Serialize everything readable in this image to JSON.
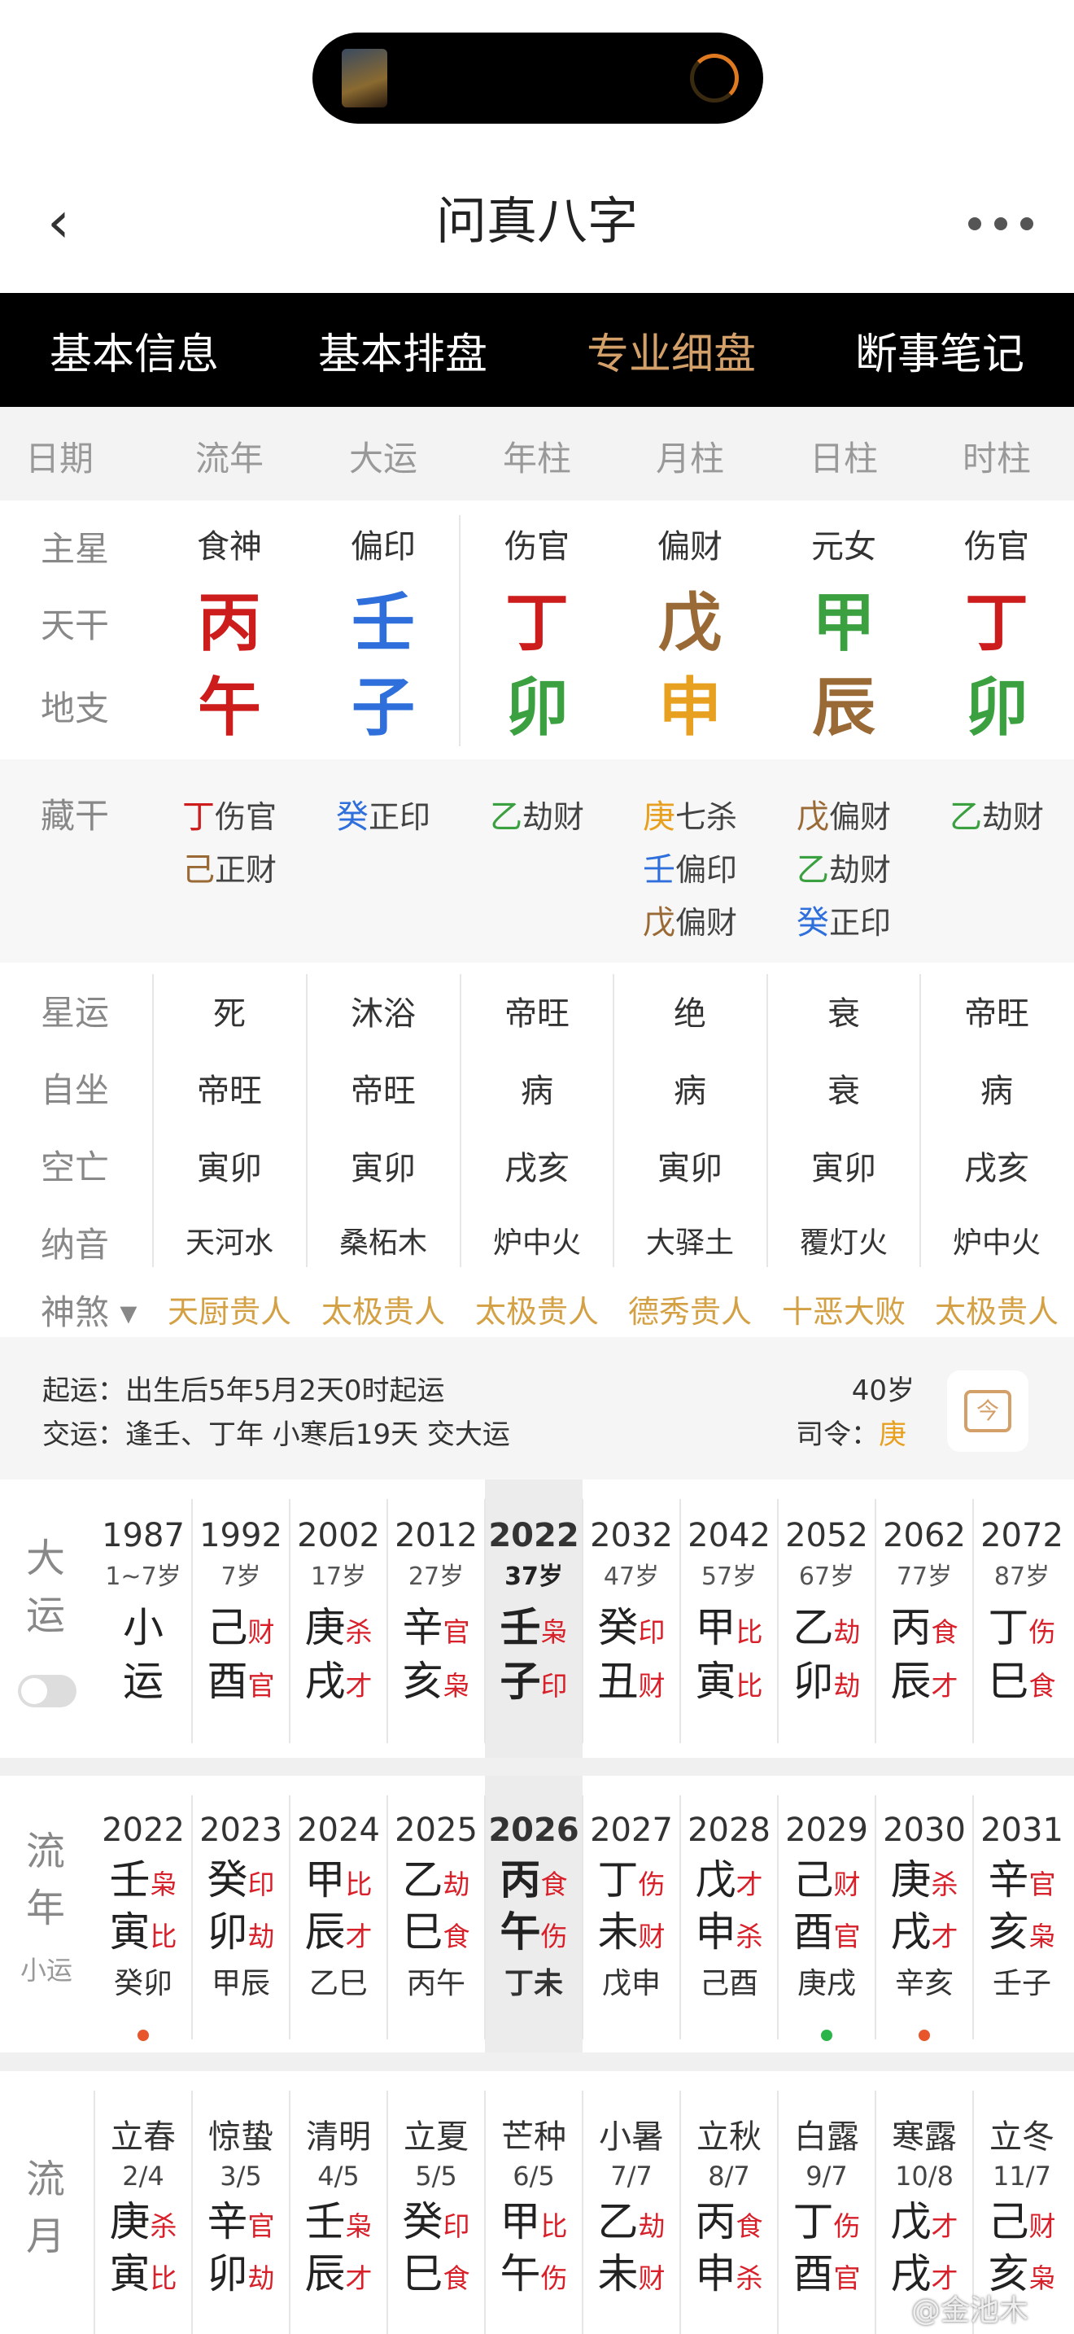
{
  "header": {
    "title": "问真八字",
    "back_icon": "chevron-left-icon",
    "more_icon": "more-dots-icon"
  },
  "tabs": [
    {
      "label": "基本信息"
    },
    {
      "label": "基本排盘"
    },
    {
      "label": "专业细盘",
      "active": true
    },
    {
      "label": "断事笔记"
    }
  ],
  "columns": [
    "日期",
    "流年",
    "大运",
    "年柱",
    "月柱",
    "日柱",
    "时柱"
  ],
  "rows": {
    "zhuxing": {
      "label": "主星",
      "values": [
        "食神",
        "偏印",
        "伤官",
        "偏财",
        "元女",
        "伤官"
      ]
    },
    "tiangan": {
      "label": "天干",
      "values": [
        {
          "t": "丙",
          "c": "#cc1c1c"
        },
        {
          "t": "壬",
          "c": "#2f6fdc"
        },
        {
          "t": "丁",
          "c": "#cc1c1c"
        },
        {
          "t": "戊",
          "c": "#9a6a36"
        },
        {
          "t": "甲",
          "c": "#3aa040"
        },
        {
          "t": "丁",
          "c": "#cc1c1c"
        }
      ]
    },
    "dizhi": {
      "label": "地支",
      "values": [
        {
          "t": "午",
          "c": "#cc1c1c"
        },
        {
          "t": "子",
          "c": "#2f6fdc"
        },
        {
          "t": "卯",
          "c": "#3aa040"
        },
        {
          "t": "申",
          "c": "#e8a020"
        },
        {
          "t": "辰",
          "c": "#9a6a36"
        },
        {
          "t": "卯",
          "c": "#3aa040"
        }
      ]
    }
  },
  "canggan": {
    "label": "藏干",
    "pin_icon": "pin-icon",
    "columns": [
      [
        {
          "g": "丁",
          "c": "#cc1c1c",
          "s": "伤官"
        },
        {
          "g": "己",
          "c": "#9a6a36",
          "s": "正财"
        }
      ],
      [
        {
          "g": "癸",
          "c": "#2f6fdc",
          "s": "正印"
        }
      ],
      [
        {
          "g": "乙",
          "c": "#3aa040",
          "s": "劫财"
        }
      ],
      [
        {
          "g": "庚",
          "c": "#e8a020",
          "s": "七杀"
        },
        {
          "g": "壬",
          "c": "#2f6fdc",
          "s": "偏印"
        },
        {
          "g": "戊",
          "c": "#9a6a36",
          "s": "偏财"
        }
      ],
      [
        {
          "g": "戊",
          "c": "#9a6a36",
          "s": "偏财"
        },
        {
          "g": "乙",
          "c": "#3aa040",
          "s": "劫财"
        },
        {
          "g": "癸",
          "c": "#2f6fdc",
          "s": "正印"
        }
      ],
      [
        {
          "g": "乙",
          "c": "#3aa040",
          "s": "劫财"
        }
      ]
    ]
  },
  "xingyun": {
    "label": "星运",
    "values": [
      "死",
      "沐浴",
      "帝旺",
      "绝",
      "衰",
      "帝旺"
    ]
  },
  "zizuo": {
    "label": "自坐",
    "values": [
      "帝旺",
      "帝旺",
      "病",
      "病",
      "衰",
      "病"
    ]
  },
  "kongwang": {
    "label": "空亡",
    "values": [
      "寅卯",
      "寅卯",
      "戌亥",
      "寅卯",
      "寅卯",
      "戌亥"
    ]
  },
  "nayin": {
    "label": "纳音",
    "values": [
      "天河水",
      "桑柘木",
      "炉中火",
      "大驿土",
      "覆灯火",
      "炉中火"
    ]
  },
  "shensha": {
    "label": "神煞",
    "values": [
      "天厨贵人",
      "太极贵人",
      "太极贵人",
      "德秀贵人",
      "十恶大败",
      "太极贵人"
    ]
  },
  "qiyun": {
    "line1": "起运：出生后5年5月2天0时起运",
    "line2": "交运：逢壬、丁年 小寒后19天 交大运",
    "age": "40岁",
    "siling_label": "司令：",
    "siling_value": "庚",
    "cal_icon": "calendar-icon",
    "cal_char": "今"
  },
  "dayun": {
    "label": "大运",
    "items": [
      {
        "year": "1987",
        "age": "1~7岁",
        "top": {
          "g": "小",
          "c": "#333"
        },
        "bot": {
          "g": "运",
          "c": "#333"
        }
      },
      {
        "year": "1992",
        "age": "7岁",
        "top": {
          "g": "己",
          "c": "#333",
          "s": "财"
        },
        "bot": {
          "g": "酉",
          "c": "#333",
          "s": "官"
        }
      },
      {
        "year": "2002",
        "age": "17岁",
        "top": {
          "g": "庚",
          "s": "杀"
        },
        "bot": {
          "g": "戌",
          "s": "才"
        }
      },
      {
        "year": "2012",
        "age": "27岁",
        "top": {
          "g": "辛",
          "s": "官"
        },
        "bot": {
          "g": "亥",
          "s": "枭"
        }
      },
      {
        "year": "2022",
        "age": "37岁",
        "top": {
          "g": "壬",
          "s": "枭"
        },
        "bot": {
          "g": "子",
          "s": "印"
        },
        "current": true
      },
      {
        "year": "2032",
        "age": "47岁",
        "top": {
          "g": "癸",
          "s": "印"
        },
        "bot": {
          "g": "丑",
          "s": "财"
        }
      },
      {
        "year": "2042",
        "age": "57岁",
        "top": {
          "g": "甲",
          "s": "比"
        },
        "bot": {
          "g": "寅",
          "s": "比"
        }
      },
      {
        "year": "2052",
        "age": "67岁",
        "top": {
          "g": "乙",
          "s": "劫"
        },
        "bot": {
          "g": "卯",
          "s": "劫"
        }
      },
      {
        "year": "2062",
        "age": "77岁",
        "top": {
          "g": "丙",
          "s": "食"
        },
        "bot": {
          "g": "辰",
          "s": "才"
        }
      },
      {
        "year": "2072",
        "age": "87岁",
        "top": {
          "g": "丁",
          "s": "伤"
        },
        "bot": {
          "g": "巳",
          "s": "食"
        }
      }
    ]
  },
  "liunian": {
    "label1": "流",
    "label2": "年",
    "sublabel": "小运",
    "items": [
      {
        "year": "2022",
        "top": {
          "g": "壬",
          "s": "枭"
        },
        "bot": {
          "g": "寅",
          "s": "比"
        },
        "xy": "癸卯",
        "dot": "#e8552a"
      },
      {
        "year": "2023",
        "top": {
          "g": "癸",
          "s": "印"
        },
        "bot": {
          "g": "卯",
          "s": "劫"
        },
        "xy": "甲辰"
      },
      {
        "year": "2024",
        "top": {
          "g": "甲",
          "s": "比"
        },
        "bot": {
          "g": "辰",
          "s": "才"
        },
        "xy": "乙巳"
      },
      {
        "year": "2025",
        "top": {
          "g": "乙",
          "s": "劫"
        },
        "bot": {
          "g": "巳",
          "s": "食"
        },
        "xy": "丙午"
      },
      {
        "year": "2026",
        "top": {
          "g": "丙",
          "s": "食"
        },
        "bot": {
          "g": "午",
          "s": "伤"
        },
        "xy": "丁未",
        "current": true
      },
      {
        "year": "2027",
        "top": {
          "g": "丁",
          "s": "伤"
        },
        "bot": {
          "g": "未",
          "s": "财"
        },
        "xy": "戊申"
      },
      {
        "year": "2028",
        "top": {
          "g": "戊",
          "s": "才"
        },
        "bot": {
          "g": "申",
          "s": "杀"
        },
        "xy": "己酉"
      },
      {
        "year": "2029",
        "top": {
          "g": "己",
          "s": "财"
        },
        "bot": {
          "g": "酉",
          "s": "官"
        },
        "xy": "庚戌",
        "dot": "#2bb44a"
      },
      {
        "year": "2030",
        "top": {
          "g": "庚",
          "s": "杀"
        },
        "bot": {
          "g": "戌",
          "s": "才"
        },
        "xy": "辛亥",
        "dot": "#e8552a"
      },
      {
        "year": "2031",
        "top": {
          "g": "辛",
          "s": "官"
        },
        "bot": {
          "g": "亥",
          "s": "枭"
        },
        "xy": "壬子"
      }
    ]
  },
  "liuyue": {
    "label1": "流",
    "label2": "月",
    "items": [
      {
        "jie": "立春",
        "date": "2/4",
        "top": {
          "g": "庚",
          "s": "杀"
        },
        "bot": {
          "g": "寅",
          "s": "比"
        }
      },
      {
        "jie": "惊蛰",
        "date": "3/5",
        "top": {
          "g": "辛",
          "s": "官"
        },
        "bot": {
          "g": "卯",
          "s": "劫"
        }
      },
      {
        "jie": "清明",
        "date": "4/5",
        "top": {
          "g": "壬",
          "s": "枭"
        },
        "bot": {
          "g": "辰",
          "s": "才"
        }
      },
      {
        "jie": "立夏",
        "date": "5/5",
        "top": {
          "g": "癸",
          "s": "印"
        },
        "bot": {
          "g": "巳",
          "s": "食"
        }
      },
      {
        "jie": "芒种",
        "date": "6/5",
        "top": {
          "g": "甲",
          "s": "比"
        },
        "bot": {
          "g": "午",
          "s": "伤"
        }
      },
      {
        "jie": "小暑",
        "date": "7/7",
        "top": {
          "g": "乙",
          "s": "劫"
        },
        "bot": {
          "g": "未",
          "s": "财"
        }
      },
      {
        "jie": "立秋",
        "date": "8/7",
        "top": {
          "g": "丙",
          "s": "食"
        },
        "bot": {
          "g": "申",
          "s": "杀"
        }
      },
      {
        "jie": "白露",
        "date": "9/7",
        "top": {
          "g": "丁",
          "s": "伤"
        },
        "bot": {
          "g": "酉",
          "s": "官"
        }
      },
      {
        "jie": "寒露",
        "date": "10/8",
        "top": {
          "g": "戊",
          "s": "才"
        },
        "bot": {
          "g": "戌",
          "s": "才"
        }
      },
      {
        "jie": "立冬",
        "date": "11/7",
        "top": {
          "g": "己",
          "s": "财"
        },
        "bot": {
          "g": "亥",
          "s": "枭"
        }
      }
    ]
  },
  "watermark": "@金池木"
}
